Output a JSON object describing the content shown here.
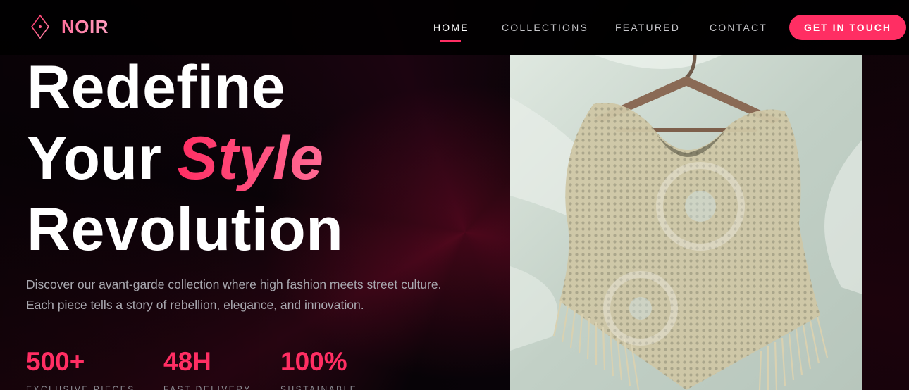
{
  "brand": {
    "name": "NOIR",
    "logo_icon": "diamond-icon"
  },
  "nav": {
    "links": [
      "HOME",
      "COLLECTIONS",
      "FEATURED",
      "CONTACT"
    ],
    "active": "HOME",
    "cta_label": "GET IN TOUCH"
  },
  "hero": {
    "title_line1": "Redefine",
    "title_line2_plain": "Your",
    "title_line2_accent": "Style",
    "title_line3": "Revolution",
    "description": "Discover our avant-garde collection where high fashion meets street culture. Each piece tells a story of rebellion, elegance, and innovation."
  },
  "stats": [
    {
      "value": "500+",
      "label": "EXCLUSIVE PIECES"
    },
    {
      "value": "48H",
      "label": "FAST DELIVERY"
    },
    {
      "value": "100%",
      "label": "SUSTAINABLE"
    }
  ],
  "colors": {
    "accent": "#ff2e63",
    "background": "#060406"
  },
  "image": {
    "subject": "crochet-poncho-on-hanger"
  }
}
